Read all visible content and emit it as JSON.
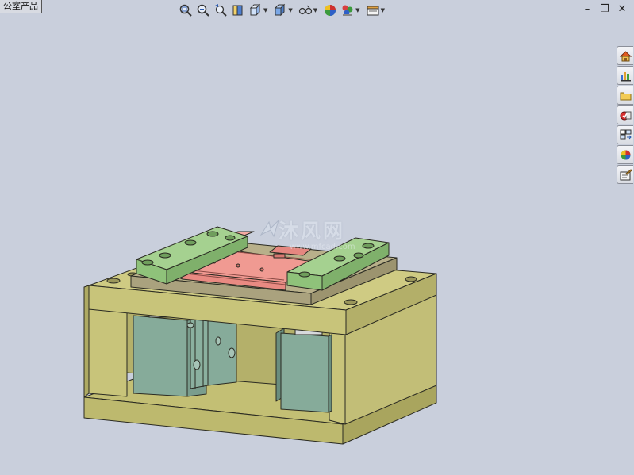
{
  "model_tab": {
    "label": "公室产品"
  },
  "toolbar": {
    "buttons": [
      {
        "icon": "zoom-to-fit-icon",
        "has_menu": false
      },
      {
        "icon": "zoom-to-area-icon",
        "has_menu": false
      },
      {
        "icon": "previous-view-icon",
        "has_menu": false
      },
      {
        "icon": "section-view-icon",
        "has_menu": false
      },
      {
        "icon": "view-orientation-icon",
        "has_menu": true
      },
      {
        "icon": "display-style-icon",
        "has_menu": true
      },
      {
        "icon": "hide-show-items-icon",
        "has_menu": true
      },
      {
        "icon": "edit-appearance-icon",
        "has_menu": false
      },
      {
        "icon": "apply-scene-icon",
        "has_menu": true
      },
      {
        "icon": "view-settings-icon",
        "has_menu": true
      }
    ]
  },
  "window_controls": {
    "minimize": "–",
    "restore": "❐",
    "close": "✕"
  },
  "task_pane": [
    "home-icon",
    "resources-icon",
    "file-explorer-icon",
    "design-library-icon",
    "view-palette-icon",
    "appearances-icon",
    "custom-properties-icon"
  ],
  "watermark": {
    "text": "沐风网",
    "url": "www.mfcad.com"
  },
  "colors": {
    "background": "#c9cfdc",
    "frame": "#c8c47a",
    "clamp": "#8fc27a",
    "part": "#f09a92",
    "cylinder": "#7fa695"
  }
}
